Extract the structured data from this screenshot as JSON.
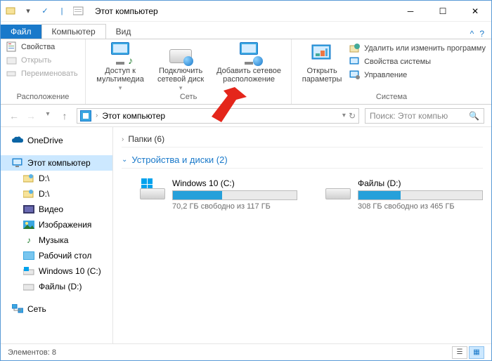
{
  "window": {
    "title": "Этот компьютер"
  },
  "quick_access": {
    "system_menu": "▾",
    "check": "✓",
    "separator": "|"
  },
  "tabs": {
    "file": "Файл",
    "computer": "Компьютер",
    "view": "Вид"
  },
  "ribbon": {
    "location": {
      "label": "Расположение",
      "properties": "Свойства",
      "open": "Открыть",
      "rename": "Переименовать"
    },
    "network": {
      "label": "Сеть",
      "media": "Доступ к мультимедиа",
      "map_drive": "Подключить сетевой диск",
      "add_location": "Добавить сетевое расположение"
    },
    "system": {
      "label": "Система",
      "open_params": "Открыть параметры",
      "uninstall": "Удалить или изменить программу",
      "sys_props": "Свойства системы",
      "manage": "Управление"
    }
  },
  "nav": {
    "addr": "Этот компьютер",
    "search_placeholder": "Поиск: Этот компью"
  },
  "sidebar": {
    "onedrive": "OneDrive",
    "this_pc": "Этот компьютер",
    "d_short": "D:\\",
    "d_short2": "D:\\",
    "video": "Видео",
    "pictures": "Изображения",
    "music": "Музыка",
    "desktop": "Рабочий стол",
    "win_c": "Windows 10 (C:)",
    "files_d": "Файлы (D:)",
    "network": "Сеть"
  },
  "content": {
    "folders_head": "Папки (6)",
    "devices_head": "Устройства и диски (2)",
    "drives": [
      {
        "title": "Windows 10 (C:)",
        "sub": "70,2 ГБ свободно из 117 ГБ",
        "fill": 40,
        "logo": true
      },
      {
        "title": "Файлы (D:)",
        "sub": "308 ГБ свободно из 465 ГБ",
        "fill": 34,
        "logo": false
      }
    ]
  },
  "status": {
    "elements": "Элементов: 8"
  }
}
